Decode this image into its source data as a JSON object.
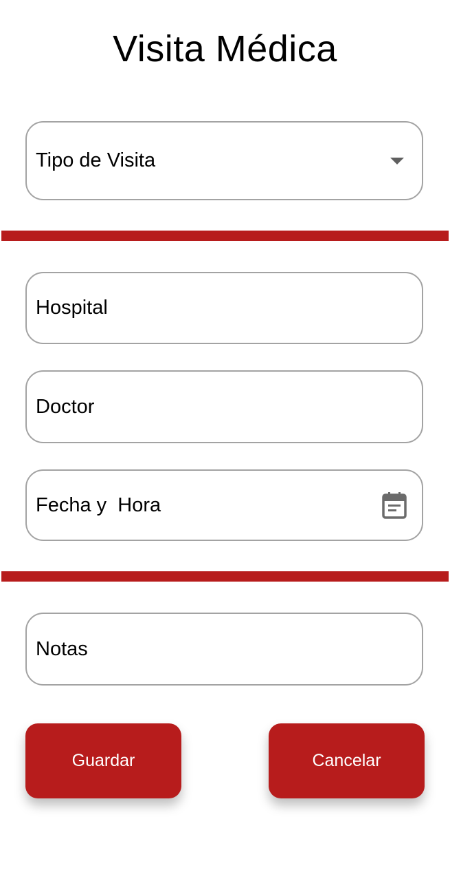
{
  "page": {
    "title": "Visita Médica"
  },
  "form": {
    "visit_type": {
      "label": "Tipo de Visita",
      "icon": "dropdown-caret-icon"
    },
    "hospital": {
      "label": "Hospital"
    },
    "doctor": {
      "label": "Doctor"
    },
    "datetime": {
      "label": "Fecha y  Hora",
      "icon": "calendar-icon"
    },
    "notes": {
      "label": "Notas"
    }
  },
  "actions": {
    "save_label": "Guardar",
    "cancel_label": "Cancelar"
  },
  "colors": {
    "accent": "#b71c1c",
    "border": "#a3a3a3",
    "icon": "#6b6b6b"
  }
}
